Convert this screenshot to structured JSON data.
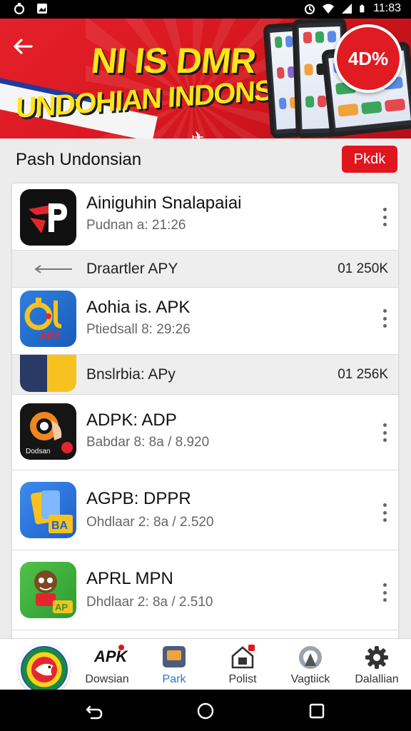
{
  "status_bar": {
    "time": "11:83"
  },
  "banner": {
    "title_line1": "NI IS DMR !",
    "title_line2": "UNDOHIAN INDONSIA",
    "discount": "4D%"
  },
  "section": {
    "title": "Pash Undonsian",
    "action_label": "Pkdk"
  },
  "apps": [
    {
      "name": "Ainiguhin Snalapaiai",
      "meta": "Pudnan a: 21:26",
      "icon": "red-p-logo-icon"
    },
    {
      "name": "Aohia is. APK",
      "meta": "Ptiedsall 8: 29:26",
      "icon": "blue-yellow-app-icon"
    },
    {
      "name": "ADPK: ADP",
      "meta": "Babdar 8: 8a / 8.920",
      "icon": "orange-hand-app-icon"
    },
    {
      "name": "AGPB: DPPR",
      "meta": "Ohdlaar 2: 8a / 2.520",
      "icon": "blue-ba-app-icon"
    },
    {
      "name": "APRL MPN",
      "meta": "Dhdlaar 2: 8a / 2.510",
      "icon": "green-mascot-app-icon"
    }
  ],
  "sub_rows": [
    {
      "label": "Draartler APY",
      "size": "01 250K"
    },
    {
      "label": "Bnslrbia: APy",
      "size": "01 256K"
    }
  ],
  "bottom_nav": [
    {
      "label": "Dowsian",
      "icon_text": "APK",
      "active": false
    },
    {
      "label": "Park",
      "active": true
    },
    {
      "label": "Polist",
      "active": false
    },
    {
      "label": "Vagtiick",
      "active": false
    },
    {
      "label": "Dalallian",
      "active": false
    }
  ],
  "colors": {
    "brand_red": "#e0161f",
    "banner_yellow": "#ffe51a",
    "active_blue": "#2a73d9"
  }
}
